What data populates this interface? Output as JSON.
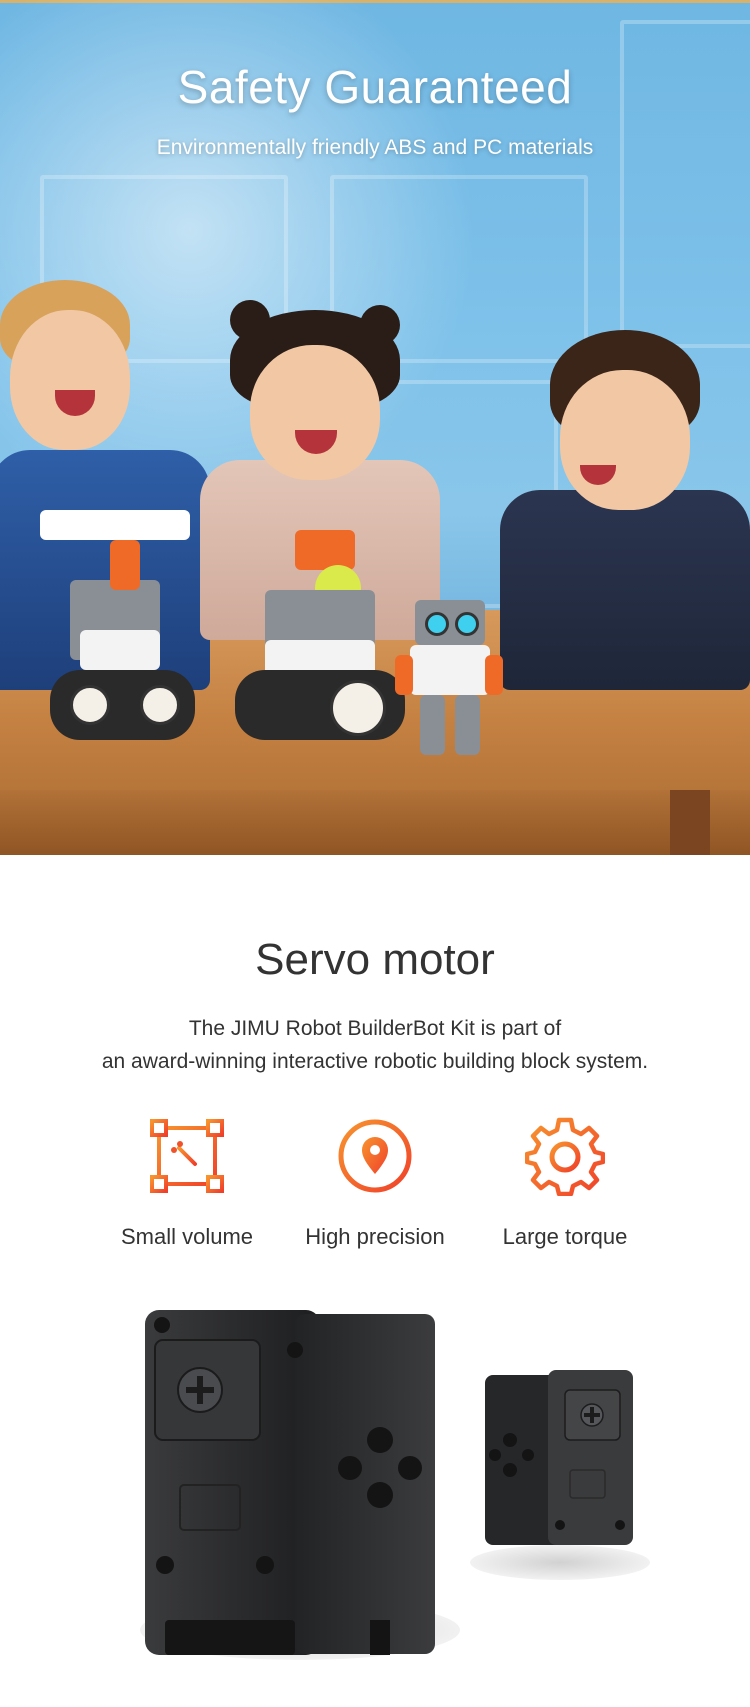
{
  "hero": {
    "title": "Safety Guaranteed",
    "subtitle": "Environmentally friendly ABS and PC materials"
  },
  "servo": {
    "title": "Servo motor",
    "description_line1": "The JIMU Robot BuilderBot Kit is part of",
    "description_line2": "an award-winning interactive robotic building block system.",
    "features": [
      {
        "label": "Small volume",
        "icon": "resize-box-icon"
      },
      {
        "label": "High precision",
        "icon": "target-pin-icon"
      },
      {
        "label": "Large torque",
        "icon": "gear-icon"
      }
    ]
  },
  "colors": {
    "accent": "#f0522a",
    "accent_light": "#f7942e",
    "text": "#333333"
  }
}
